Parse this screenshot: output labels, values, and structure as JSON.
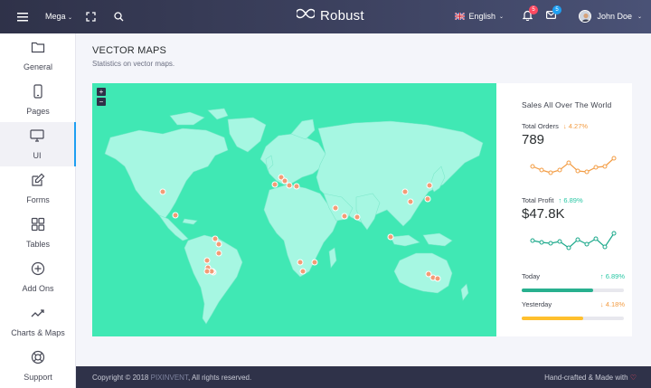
{
  "navbar": {
    "mega_label": "Mega",
    "brand": "Robust",
    "language": "English",
    "notifications_count": "5",
    "messages_count": "5",
    "user_name": "John Doe"
  },
  "sidebar": {
    "items": [
      {
        "label": "General",
        "icon": "folder-icon",
        "active": false
      },
      {
        "label": "Pages",
        "icon": "phone-icon",
        "active": false
      },
      {
        "label": "UI",
        "icon": "monitor-icon",
        "active": true
      },
      {
        "label": "Forms",
        "icon": "edit-icon",
        "active": false
      },
      {
        "label": "Tables",
        "icon": "grid-icon",
        "active": false
      },
      {
        "label": "Add Ons",
        "icon": "plus-circle-icon",
        "active": false
      },
      {
        "label": "Charts & Maps",
        "icon": "trend-icon",
        "active": false
      },
      {
        "label": "Support",
        "icon": "lifebuoy-icon",
        "active": false
      }
    ]
  },
  "page": {
    "title": "VECTOR MAPS",
    "subtitle": "Statistics on vector maps."
  },
  "map": {
    "zoom_in": "+",
    "zoom_out": "−"
  },
  "stats": {
    "title": "Sales All Over The World",
    "orders_label": "Total Orders",
    "orders_delta": "↓ 4.27%",
    "orders_value": "789",
    "profit_label": "Total Profit",
    "profit_delta": "↑ 6.89%",
    "profit_value": "$47.8K",
    "today_label": "Today",
    "today_value": "↑ 6.89%",
    "today_progress": 0.7,
    "yesterday_label": "Yesterday",
    "yesterday_value": "↓ 4.18%",
    "yesterday_progress": 0.6,
    "colors": {
      "orange": "#f39c43",
      "green": "#1aa88a",
      "teal": "#28c7a4",
      "yellow": "#ffc02e"
    }
  },
  "footer": {
    "copyright": "Copyright © 2018",
    "company": "PIXINVENT",
    "rights": ", All rights reserved.",
    "made_with": "Hand-crafted & Made with"
  }
}
